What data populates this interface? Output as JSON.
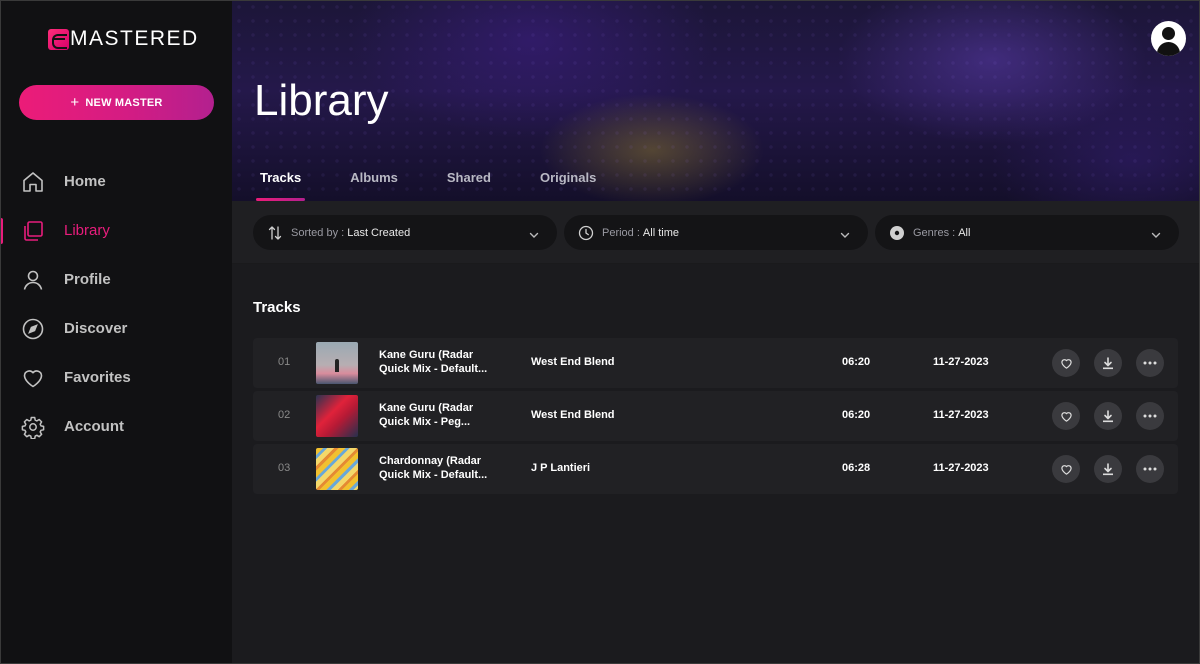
{
  "app": {
    "brand": "MASTERED",
    "accent": "#e81d7c"
  },
  "sidebar": {
    "new_master_label": "NEW MASTER",
    "items": [
      {
        "label": "Home",
        "icon": "home-icon",
        "active": false
      },
      {
        "label": "Library",
        "icon": "library-icon",
        "active": true
      },
      {
        "label": "Profile",
        "icon": "user-icon",
        "active": false
      },
      {
        "label": "Discover",
        "icon": "compass-icon",
        "active": false
      },
      {
        "label": "Favorites",
        "icon": "heart-icon",
        "active": false
      },
      {
        "label": "Account",
        "icon": "gear-icon",
        "active": false
      }
    ]
  },
  "header": {
    "title": "Library",
    "tabs": [
      {
        "label": "Tracks",
        "active": true
      },
      {
        "label": "Albums",
        "active": false
      },
      {
        "label": "Shared",
        "active": false
      },
      {
        "label": "Originals",
        "active": false
      }
    ]
  },
  "filters": {
    "sort": {
      "label": "Sorted by :",
      "value": "Last Created"
    },
    "period": {
      "label": "Period :",
      "value": "All time"
    },
    "genres": {
      "label": "Genres :",
      "value": "All"
    }
  },
  "tracks": {
    "section_title": "Tracks",
    "rows": [
      {
        "num": "01",
        "title_line1": "Kane Guru (Radar",
        "title_line2": "Quick Mix - Default...",
        "artist": "West End Blend",
        "duration": "06:20",
        "date": "11-27-2023"
      },
      {
        "num": "02",
        "title_line1": "Kane Guru (Radar",
        "title_line2": "Quick Mix - Peg...",
        "artist": "West End Blend",
        "duration": "06:20",
        "date": "11-27-2023"
      },
      {
        "num": "03",
        "title_line1": "Chardonnay (Radar",
        "title_line2": "Quick Mix - Default...",
        "artist": "J P Lantieri",
        "duration": "06:28",
        "date": "11-27-2023"
      }
    ]
  }
}
